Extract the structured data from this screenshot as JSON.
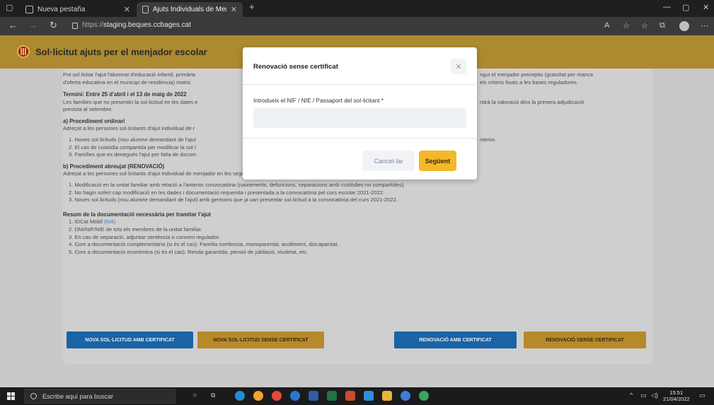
{
  "browser": {
    "tabs": [
      {
        "label": "Nueva pestaña"
      },
      {
        "label": "Ajuts Individuals de Menjador -"
      }
    ],
    "url_prefix": "https://",
    "url_host": "staging.beques.ccbages.cat"
  },
  "app": {
    "title": "Sol·licitut ajuts per el menjador escolar"
  },
  "content": {
    "intro_line1_left": "Pot sol·licitar l'ajut l'alumnat d'educació infantil, primària",
    "intro_line1_right": "ngui el menjador preceptiu (gratuïtat per manca",
    "intro_line2_left": "d'oferta educativa en el municipi de residència) matric",
    "intro_line2_right": "els criteris fixats a les bases reguladores.",
    "term_heading": "Termini: Entre 25 d'abril i el 13 de maig de 2022",
    "term_line1_left": "Les famílies que no presentin la sol·licitud en les dates e",
    "term_line1_right": "ntirà la valoració dins la primera adjudicació",
    "term_line2": "prevista al setembre.",
    "a_heading": "a) Procediment ordinari",
    "a_intro": "Adreçat a les persones sol·licitants d'ajut individual de r",
    "a_items": [
      "1. Noves sol·licituds (nou alumne demandant de l'ajut",
      "2. El cas de custòdia compartida per modificar la sol·l",
      "3. Famílies que es denegués l'ajut per falta de docum"
    ],
    "a_item1_right": "nterior.",
    "b_heading": "b) Procediment abreujat (RENOVACIÓ)",
    "b_intro": "Adreçat a les persones sol·licitants d'ajut individual de menjador en les següents situacions:",
    "b_items": [
      "1. Modificació en la unitat familiar amb relació a l'anterior convocatòria (naixements, defuncions, separacions amb custòdies no compartides).",
      "2. No hagin sofert cap modificació en les dades i documentació requerida i presentada a la convocatòria pel curs escolar 2021-2022.",
      "3. Noves sol·licituds (nou alumne demandant de l'ajut) amb germans que ja van presentar sol·licitud a la convocatòria del curs 2021-2022."
    ],
    "doc_heading": "Resum de la documentació necessària per tramitar l'ajut",
    "doc_item1_prefix": "1. IDCat Mòbil",
    "doc_item1_link": "(link)",
    "doc_items": [
      "2. DNI/NIF/NIE de tots els membres de la unitat familiar.",
      "3. En cas de separació, adjuntar sentència o conveni regulador.",
      "4. Com a documentació complementària (si és el cas): Família nombrosa, monoparental, acolliment, discapacitat.",
      "5. Com a documentació econòmica (si és el cas): Renda garantida, pensió de jubilació, viudetat, etc."
    ]
  },
  "actions": {
    "new_with_cert": "NOVA SOL·LICITUD AMB CERTIFICAT",
    "new_without_cert": "NOVA SOL·LICITUD SENSE CERTIFICAT",
    "renew_with_cert": "RENOVACIÓ AMB CERTIFICAT",
    "renew_without_cert": "RENOVACIÓ SENSE CERTIFICAT"
  },
  "modal": {
    "title": "Renovació sense certificat",
    "field_label": "Introdueix el NIF / NIE / Passaport del sol·licitant *",
    "field_value": "",
    "cancel_label": "Cancel·lar",
    "next_label": "Següent"
  },
  "taskbar": {
    "search_placeholder": "Escribe aquí para buscar",
    "time": "15:51",
    "date": "21/04/2022"
  },
  "colors": {
    "header_gold": "#ad8a2f",
    "primary_blue": "#1a63a4",
    "accent_gold": "#f3b82b"
  }
}
